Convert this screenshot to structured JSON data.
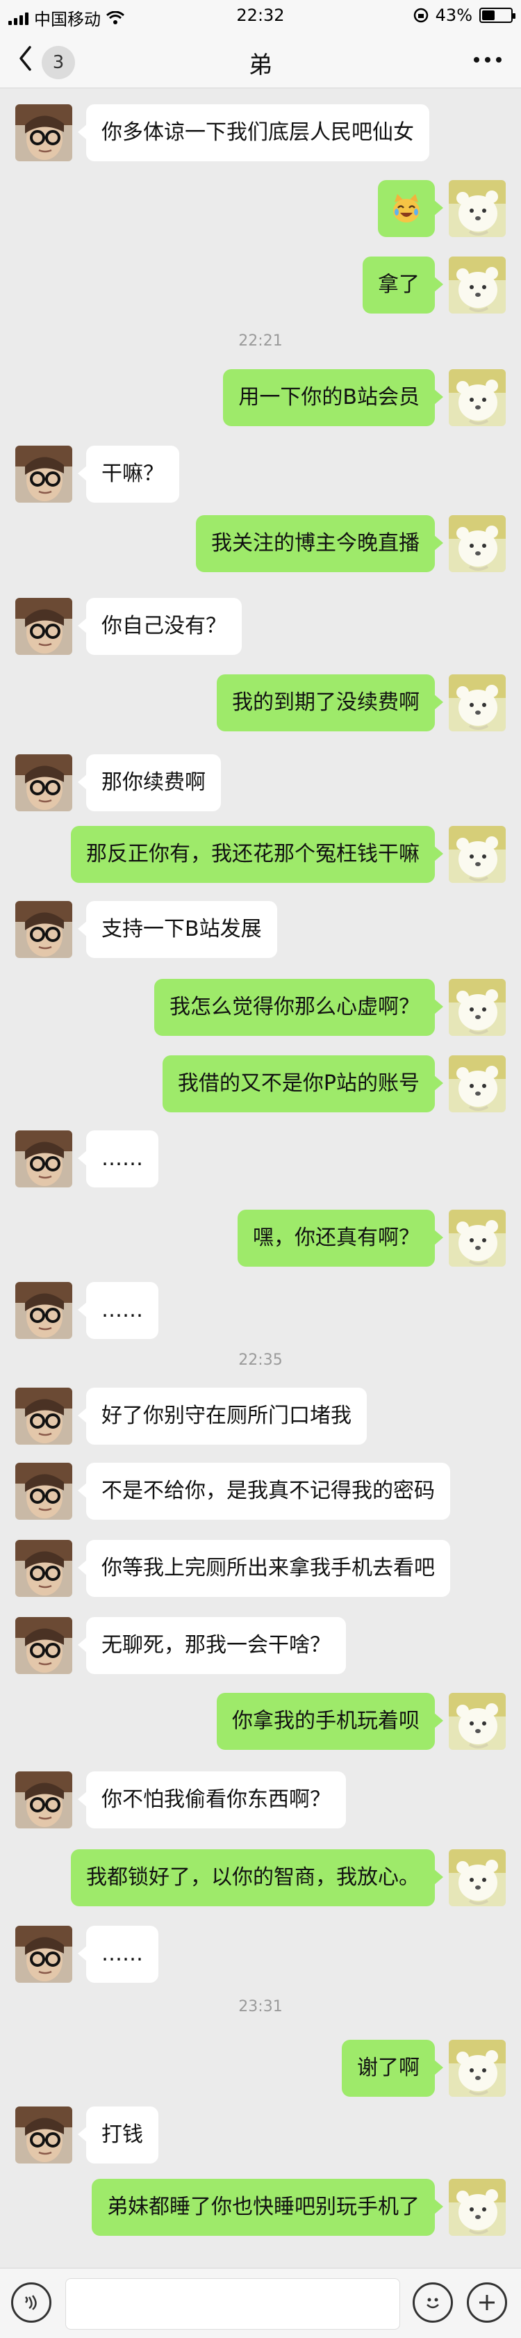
{
  "status_bar": {
    "carrier": "中国移动",
    "time": "22:32",
    "battery_percent": "43%"
  },
  "nav": {
    "back_count": "3",
    "title": "弟"
  },
  "messages": [
    {
      "type": "msg",
      "side": "left",
      "text": "你多体谅一下我们底层人民吧仙女"
    },
    {
      "type": "msg",
      "side": "right",
      "text": "",
      "sticker": "laughing-cat-emoji"
    },
    {
      "type": "msg",
      "side": "right",
      "text": "拿了"
    },
    {
      "type": "time",
      "text": "22:21"
    },
    {
      "type": "msg",
      "side": "right",
      "text": "用一下你的B站会员"
    },
    {
      "type": "msg",
      "side": "left",
      "text": "干嘛？"
    },
    {
      "type": "msg",
      "side": "right",
      "text": "我关注的博主今晚直播"
    },
    {
      "type": "msg",
      "side": "left",
      "text": "你自己没有？"
    },
    {
      "type": "msg",
      "side": "right",
      "text": "我的到期了没续费啊"
    },
    {
      "type": "msg",
      "side": "left",
      "text": "那你续费啊"
    },
    {
      "type": "msg",
      "side": "right",
      "text": "那反正你有，我还花那个冤枉钱干嘛"
    },
    {
      "type": "msg",
      "side": "left",
      "text": "支持一下B站发展"
    },
    {
      "type": "msg",
      "side": "right",
      "text": "我怎么觉得你那么心虚啊？"
    },
    {
      "type": "msg",
      "side": "right",
      "text": "我借的又不是你P站的账号"
    },
    {
      "type": "msg",
      "side": "left",
      "text": "……"
    },
    {
      "type": "msg",
      "side": "right",
      "text": "嘿，你还真有啊？"
    },
    {
      "type": "msg",
      "side": "left",
      "text": "……"
    },
    {
      "type": "time",
      "text": "22:35"
    },
    {
      "type": "msg",
      "side": "left",
      "text": "好了你别守在厕所门口堵我"
    },
    {
      "type": "msg",
      "side": "left",
      "text": "不是不给你，是我真不记得我的密码"
    },
    {
      "type": "msg",
      "side": "left",
      "text": "你等我上完厕所出来拿我手机去看吧"
    },
    {
      "type": "msg",
      "side": "left",
      "text": "无聊死，那我一会干啥？"
    },
    {
      "type": "msg",
      "side": "right",
      "text": "你拿我的手机玩着呗"
    },
    {
      "type": "msg",
      "side": "left",
      "text": "你不怕我偷看你东西啊？"
    },
    {
      "type": "msg",
      "side": "right",
      "text": "我都锁好了，以你的智商，我放心。"
    },
    {
      "type": "msg",
      "side": "left",
      "text": "……"
    },
    {
      "type": "time",
      "text": "23:31"
    },
    {
      "type": "msg",
      "side": "right",
      "text": "谢了啊"
    },
    {
      "type": "msg",
      "side": "left",
      "text": "打钱"
    },
    {
      "type": "msg",
      "side": "right",
      "text": "弟妹都睡了你也快睡吧别玩手机了"
    }
  ],
  "input_bar": {
    "voice_icon": "voice-icon",
    "emoji_icon": "emoji-icon",
    "plus_icon": "plus-icon"
  }
}
